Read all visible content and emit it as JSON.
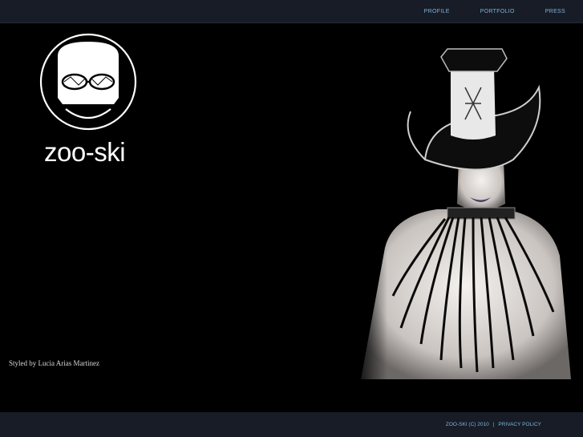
{
  "nav": {
    "items": [
      {
        "label": "PROFILE"
      },
      {
        "label": "PORTFOLIO"
      },
      {
        "label": "PRESS"
      }
    ]
  },
  "brand": {
    "name": "zoo-ski"
  },
  "hero": {
    "credit": "Styled by Lucia Arias Martinez"
  },
  "footer": {
    "copyright": "ZOO-SKI (C) 2010",
    "separator": "|",
    "privacy": "PRIVACY POLICY"
  },
  "colors": {
    "bar_bg": "#171c26",
    "link": "#7fb3d9",
    "page_bg": "#000000"
  }
}
